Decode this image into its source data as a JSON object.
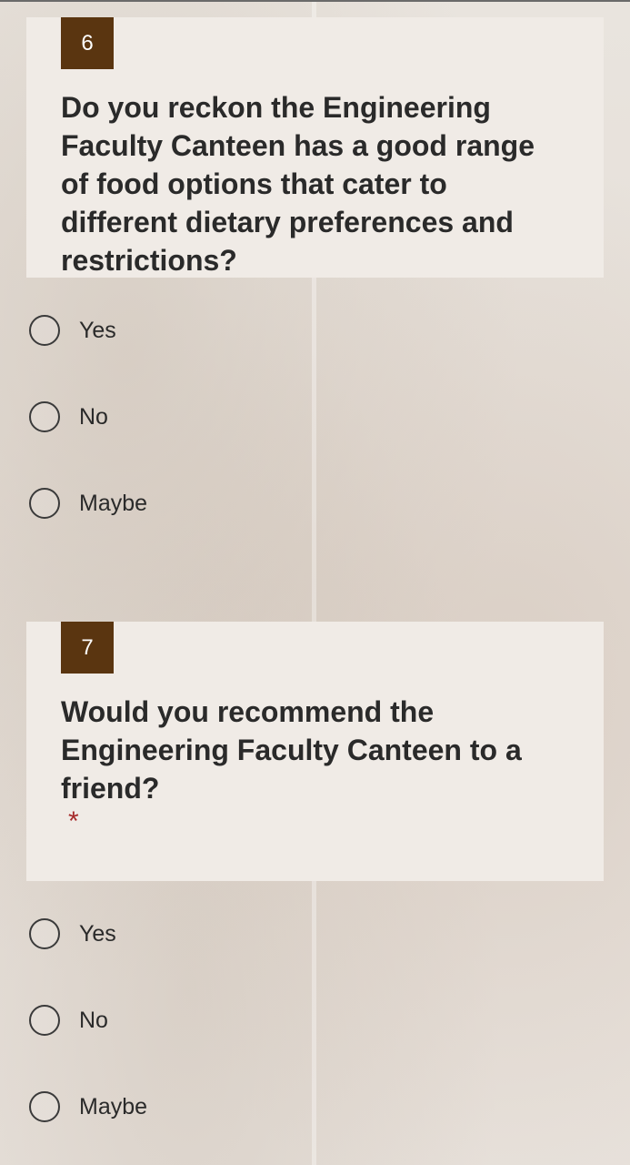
{
  "questions": [
    {
      "number": "6",
      "text": "Do you reckon the Engineering Faculty Canteen has a good range of food options that cater to different dietary preferences and restrictions?",
      "required": false,
      "options": [
        "Yes",
        "No",
        "Maybe"
      ]
    },
    {
      "number": "7",
      "text": "Would you recommend the Engineering Faculty Canteen to a friend?",
      "required": true,
      "required_marker": "*",
      "options": [
        "Yes",
        "No",
        "Maybe"
      ]
    }
  ],
  "colors": {
    "number_badge": "#5a3510",
    "card_background": "#f0ebe6",
    "required_marker": "#a62a2a"
  }
}
